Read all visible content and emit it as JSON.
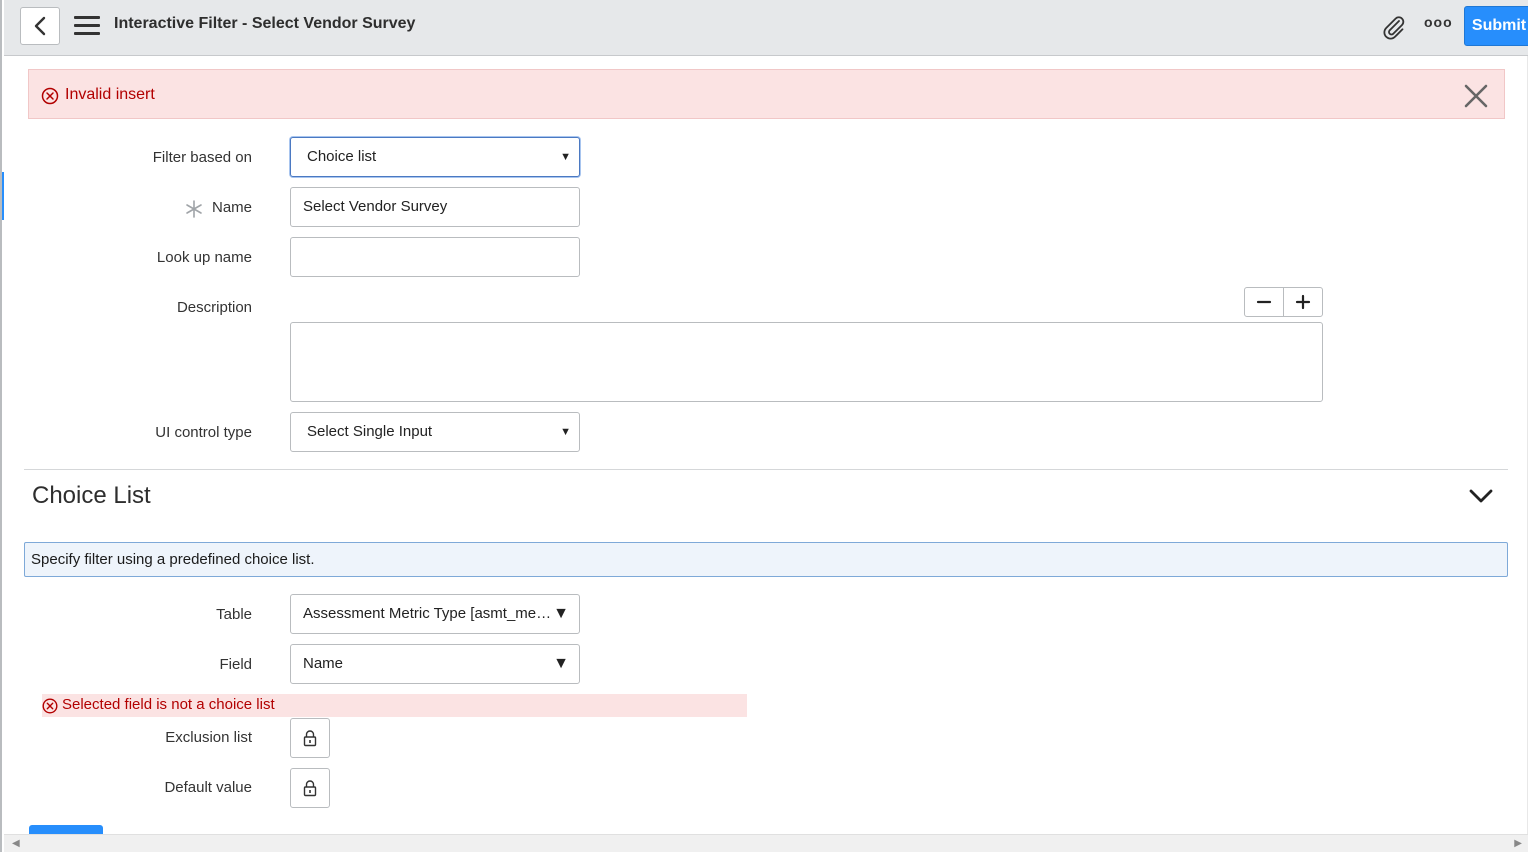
{
  "header": {
    "title": "Interactive Filter - Select Vendor Survey",
    "more_label": "ooo",
    "submit_label": "Submit"
  },
  "alert": {
    "message": "Invalid insert"
  },
  "form": {
    "filter_based_on": {
      "label": "Filter based on",
      "value": "Choice list"
    },
    "name": {
      "label": "Name",
      "value": "Select Vendor Survey"
    },
    "lookup_name": {
      "label": "Look up name",
      "value": ""
    },
    "description": {
      "label": "Description",
      "value": ""
    },
    "ui_control_type": {
      "label": "UI control type",
      "value": "Select Single Input"
    }
  },
  "choice_list": {
    "section_title": "Choice List",
    "info": "Specify filter using a predefined choice list.",
    "table": {
      "label": "Table",
      "value": "Assessment Metric Type [asmt_me…"
    },
    "field": {
      "label": "Field",
      "value": "Name"
    },
    "field_error": "Selected field is not a choice list",
    "exclusion_list": {
      "label": "Exclusion list"
    },
    "default_value": {
      "label": "Default value"
    }
  },
  "colors": {
    "accent": "#278efc",
    "error_bg": "#fbe3e3",
    "error_text": "#b20000",
    "header_bg": "#e6e8ea"
  }
}
